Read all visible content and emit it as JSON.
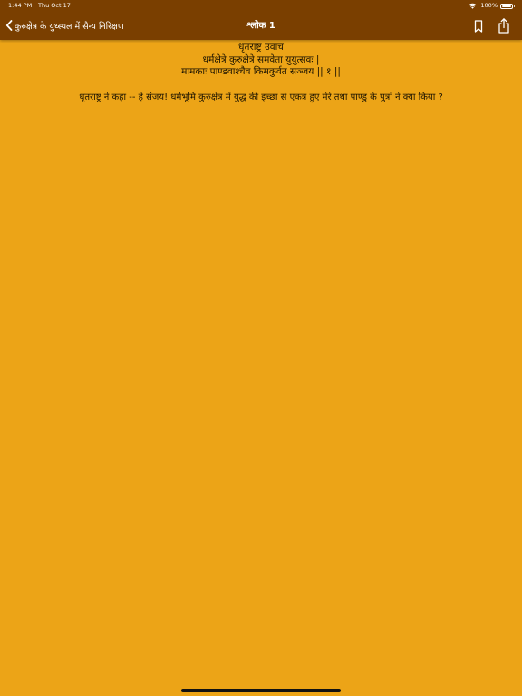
{
  "status_bar": {
    "time": "1:44 PM",
    "date": "Thu Oct 17",
    "battery": "100%"
  },
  "nav": {
    "back_label": "कुरुक्षेत्र के युध्स्थल में सैन्य निरिक्षण",
    "title": "श्लोक 1"
  },
  "verse": {
    "lines": [
      "धृतराष्ट्र उवाच",
      "धर्मक्षेत्रे कुरुक्षेत्रे समवेता युयुत्सवः |",
      "मामकाः पाण्डवाश्चैव किमकुर्वत सञ्जय || १ ||"
    ]
  },
  "translation": "धृतराष्ट्र ने कहा -- हे संजय! धर्मभूमि कुरुक्षेत्र में युद्ध की इच्छा से एकत्र हुए मेरे तथा पाण्डु के पुत्रों ने क्या किया ?",
  "colors": {
    "background": "#ECA417",
    "header": "#7A3F00",
    "text": "#1a1200"
  },
  "icons": [
    "wifi-icon",
    "battery-icon",
    "chevron-left-icon",
    "bookmark-icon",
    "share-icon"
  ]
}
